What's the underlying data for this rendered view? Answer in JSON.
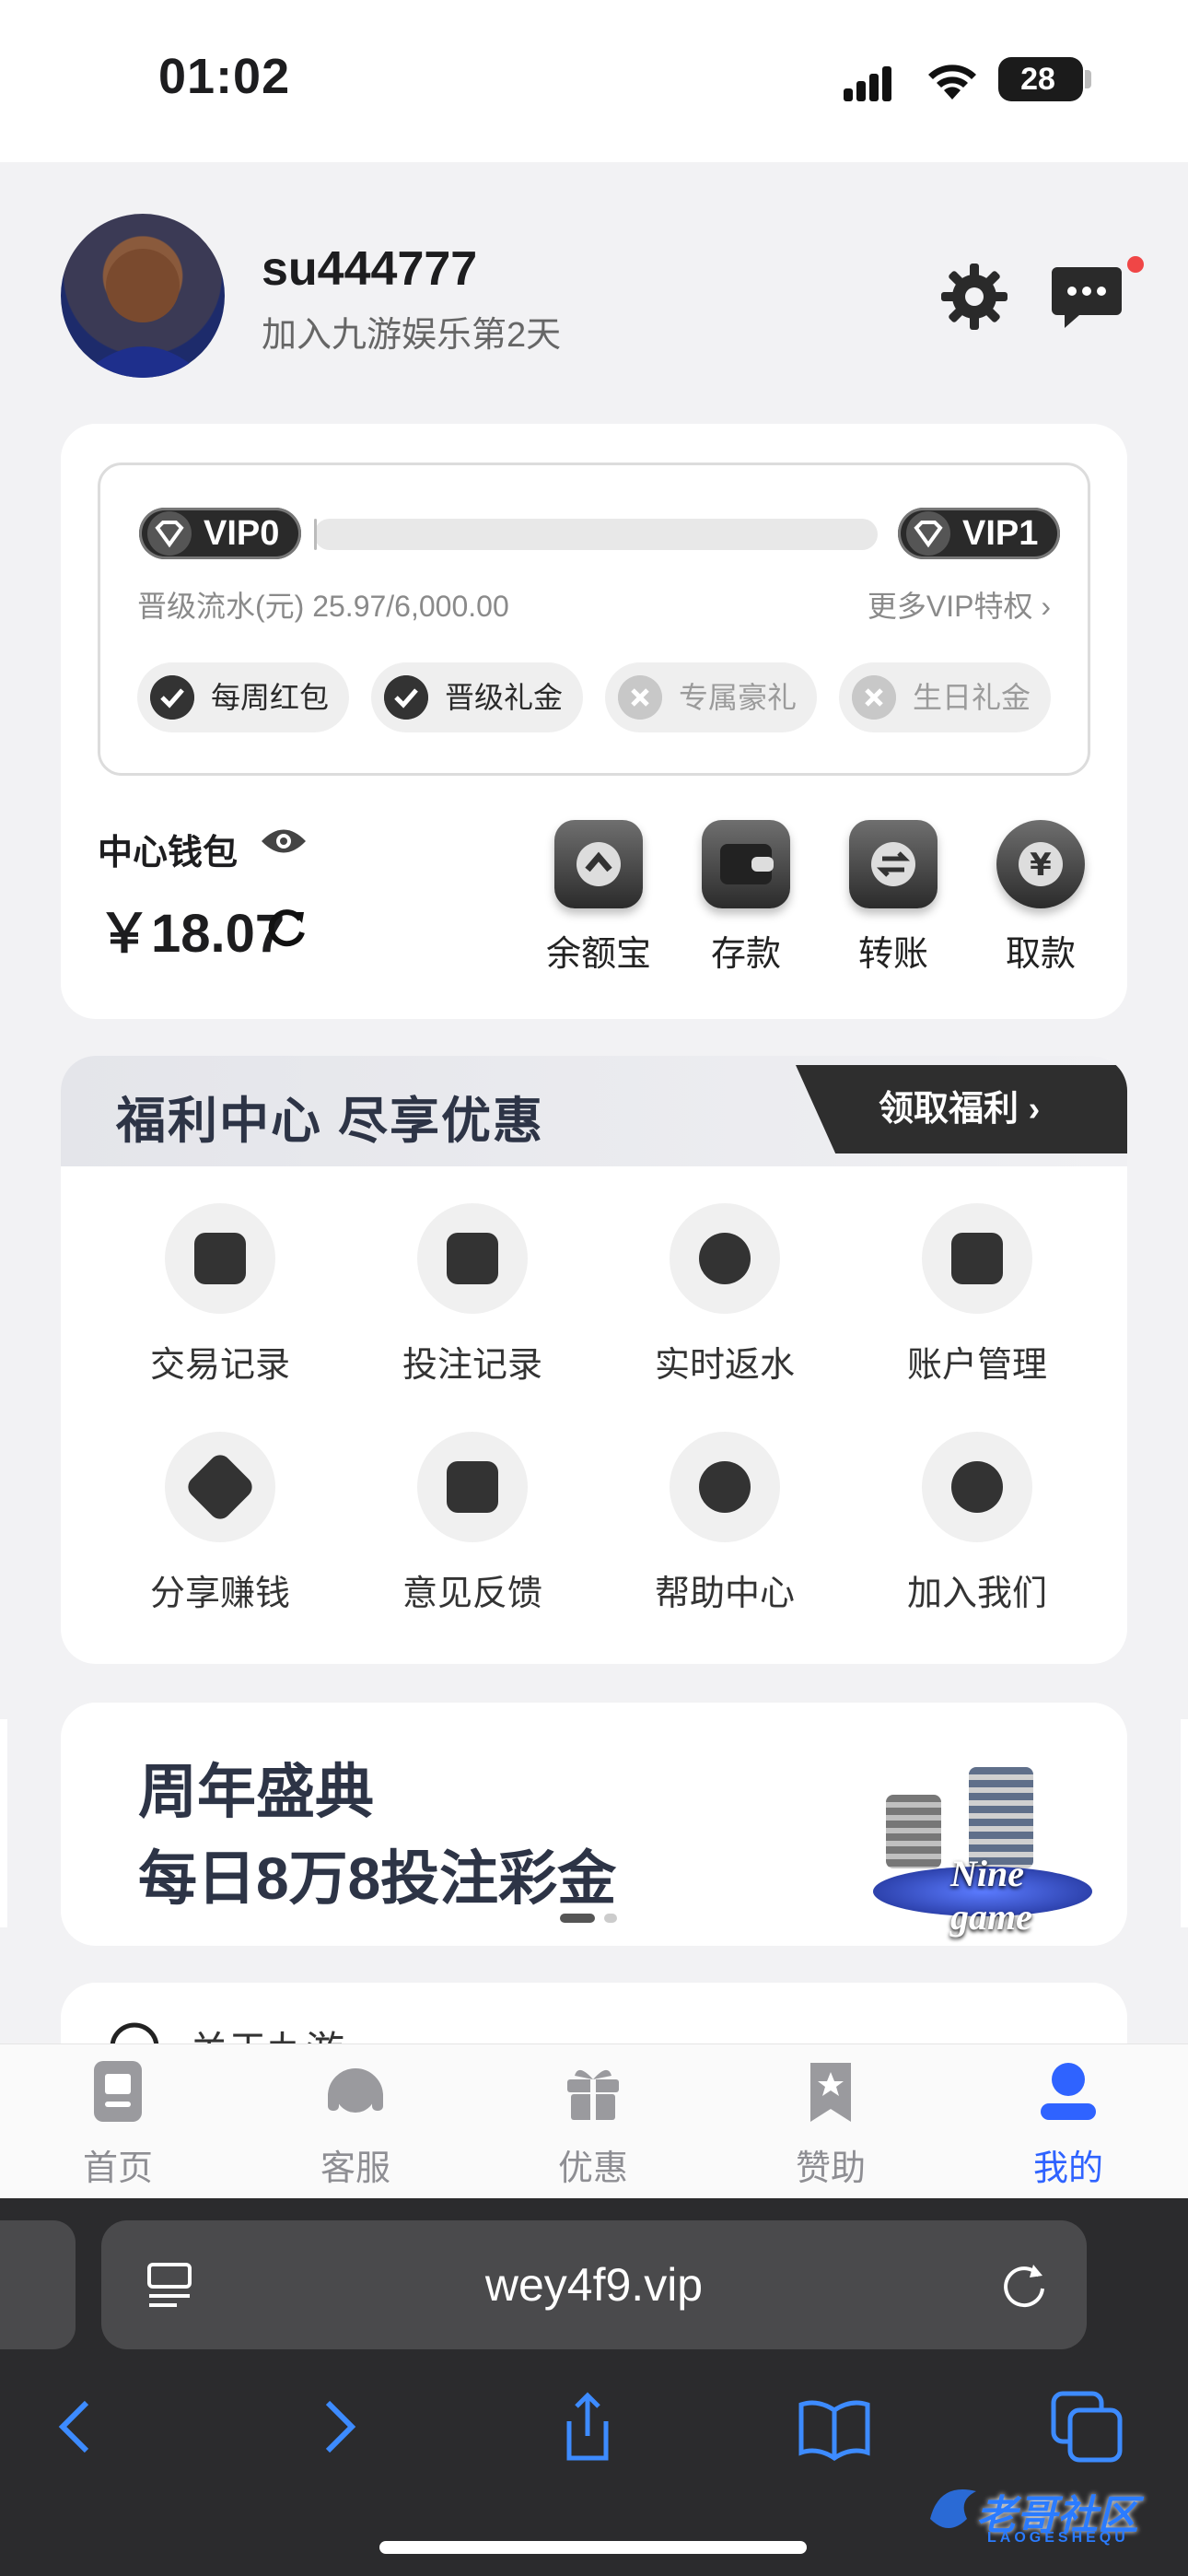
{
  "status_bar": {
    "time": "01:02",
    "battery": "28"
  },
  "header": {
    "username": "su444777",
    "join_text": "加入九游娱乐第2天"
  },
  "vip": {
    "current_level": "VIP0",
    "next_level": "VIP1",
    "progress_fraction": 0.0043,
    "flow_text": "晋级流水(元) 25.97/6,000.00",
    "more_link": "更多VIP特权",
    "perks": [
      {
        "label": "每周红包",
        "enabled": true
      },
      {
        "label": "晋级礼金",
        "enabled": true
      },
      {
        "label": "专属豪礼",
        "enabled": false
      },
      {
        "label": "生日礼金",
        "enabled": false
      }
    ]
  },
  "wallet": {
    "label": "中心钱包",
    "balance": "￥18.07",
    "actions": [
      {
        "label": "余额宝",
        "icon": "up-arrow-icon"
      },
      {
        "label": "存款",
        "icon": "wallet-icon"
      },
      {
        "label": "转账",
        "icon": "transfer-icon"
      },
      {
        "label": "取款",
        "icon": "yen-icon"
      }
    ]
  },
  "welfare": {
    "title": "福利中心 尽享优惠",
    "button": "领取福利",
    "items": [
      {
        "label": "交易记录",
        "icon": "wallet-icon"
      },
      {
        "label": "投注记录",
        "icon": "calendar-icon"
      },
      {
        "label": "实时返水",
        "icon": "percent-badge-icon"
      },
      {
        "label": "账户管理",
        "icon": "id-card-icon"
      },
      {
        "label": "分享赚钱",
        "icon": "handshake-icon"
      },
      {
        "label": "意见反馈",
        "icon": "edit-note-icon"
      },
      {
        "label": "帮助中心",
        "icon": "exclamation-icon"
      },
      {
        "label": "加入我们",
        "icon": "question-icon"
      }
    ]
  },
  "banner": {
    "line1": "周年盛典",
    "line2": "每日8万8投注彩金",
    "brand": "Nine game"
  },
  "next_section": {
    "label": "关于九游"
  },
  "tabbar": {
    "tabs": [
      {
        "label": "首页",
        "icon": "document-icon",
        "active": false
      },
      {
        "label": "客服",
        "icon": "headset-icon",
        "active": false
      },
      {
        "label": "优惠",
        "icon": "gift-icon",
        "active": false
      },
      {
        "label": "赞助",
        "icon": "bookmark-star-icon",
        "active": false
      },
      {
        "label": "我的",
        "icon": "person-icon",
        "active": true
      }
    ]
  },
  "browser": {
    "url": "wey4f9.vip"
  },
  "watermark": {
    "text": "老哥社区",
    "sub": "LAOGESHEQU"
  },
  "colors": {
    "accent": "#2f63ff",
    "dark": "#2e2e2e",
    "badge_red": "#f04646"
  }
}
